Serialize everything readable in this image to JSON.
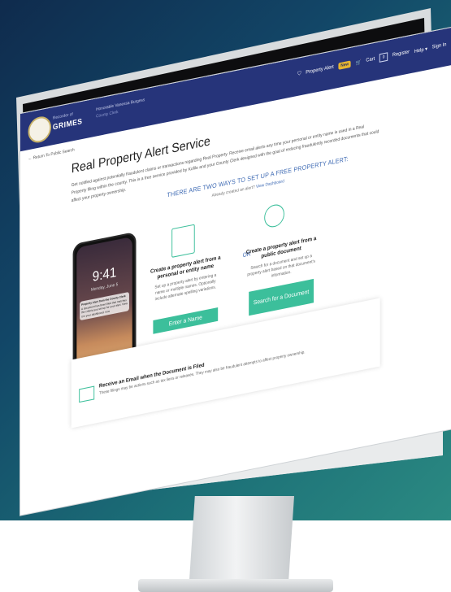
{
  "header": {
    "county_small": "Recorder of",
    "county_big": "GRIMES",
    "county_mid": "Honorable Vanessa Burgess",
    "county_mid2": "County Clerk",
    "property_alert_label": "Property Alert",
    "new_badge": "New",
    "cart_label": "Cart",
    "cart_count": "0",
    "register_label": "Register",
    "help_label": "Help",
    "signin_label": "Sign In"
  },
  "page": {
    "return_link": "← Return To Public Search",
    "title": "Real Property Alert Service",
    "description": "Get notified against potentially fraudulent claims or transactions regarding Real Property. Receive email alerts any time your personal or entity name is used in a Real Property filing within the county. This is a free service provided by Kofile and your County Clerk designed with the goal of reducing fraudulently recorded documents that could affect your property ownership.",
    "ways_heading": "THERE ARE TWO WAYS TO SET UP A FREE PROPERTY ALERT:",
    "already_text": "Already created an alert?",
    "dashboard_link": "View Dashboard"
  },
  "phone": {
    "time": "9:41",
    "date": "Monday, June 5",
    "notif_title": "Property Alert from the County Clerk",
    "notif_text": "A document has been filed that matches the criteria you set up for your alert. View it in your dashboard.",
    "notif_time": "now"
  },
  "option_name": {
    "title": "Create a property alert from a personal or entity name",
    "text": "Set up a property alert by entering a name or multiple names. Optionally include alternate spelling variations.",
    "button": "Enter a Name"
  },
  "or_label": "OR",
  "option_doc": {
    "title": "Create a property alert from a public document",
    "text": "Search for a document and set up a property alert based on that document's information.",
    "button": "Search for a Document"
  },
  "info": {
    "title": "Receive an Email when the Document is Filed",
    "text": "These filings may be actions such as tax liens or releases. They may also be fraudulent attempts to affect property ownership."
  },
  "colors": {
    "navy": "#26347a",
    "accent": "#3cbf9b",
    "link_blue": "#3f6bb4"
  }
}
